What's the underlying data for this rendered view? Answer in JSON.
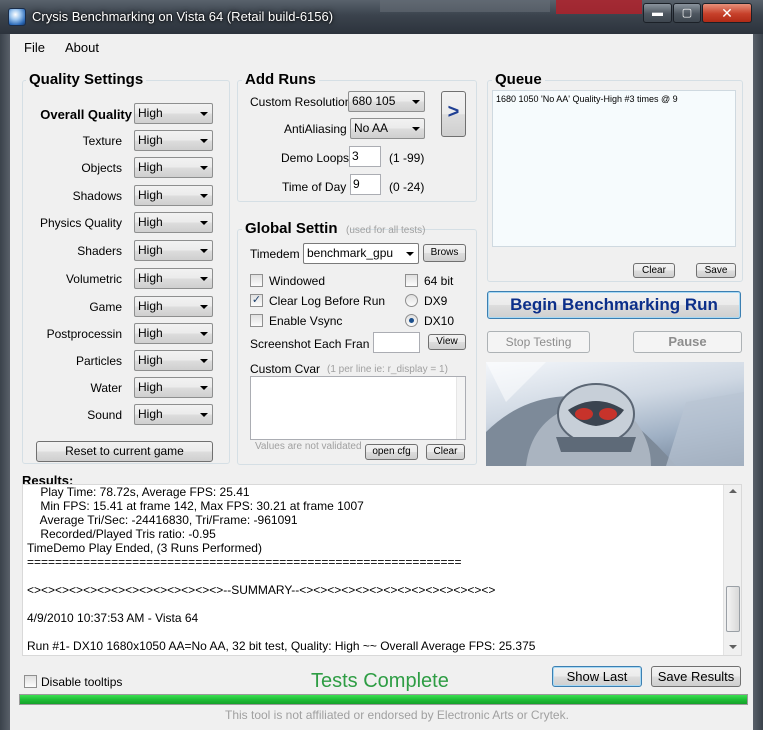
{
  "window": {
    "title": "Crysis Benchmarking on Vista 64 (Retail build-6156)",
    "minimize": "▬",
    "maximize": "▢",
    "close": "✕"
  },
  "menu": {
    "file": "File",
    "about": "About"
  },
  "quality": {
    "title": "Quality Settings",
    "overall_label": "Overall Quality",
    "overall_value": "High",
    "rows": [
      {
        "label": "Texture",
        "value": "High"
      },
      {
        "label": "Objects",
        "value": "High"
      },
      {
        "label": "Shadows",
        "value": "High"
      },
      {
        "label": "Physics Quality",
        "value": "High"
      },
      {
        "label": "Shaders",
        "value": "High"
      },
      {
        "label": "Volumetric",
        "value": "High"
      },
      {
        "label": "Game",
        "value": "High"
      },
      {
        "label": "Postprocessin",
        "value": "High"
      },
      {
        "label": "Particles",
        "value": "High"
      },
      {
        "label": "Water",
        "value": "High"
      },
      {
        "label": "Sound",
        "value": "High"
      }
    ],
    "reset_button": "Reset to current game"
  },
  "add_runs": {
    "title": "Add Runs",
    "resolution_label": "Custom Resolution",
    "resolution_value": "680 105",
    "aa_label": "AntiAliasing",
    "aa_value": "No AA",
    "loops_label": "Demo Loops",
    "loops_value": "3",
    "loops_range": "(1 -99)",
    "tod_label": "Time of Day",
    "tod_value": "9",
    "tod_range": "(0 -24)",
    "add_button": ">"
  },
  "global": {
    "title": "Global Settin",
    "subtitle": "(used for all tests)",
    "timedemo_label": "Timedem",
    "timedemo_value": "benchmark_gpu",
    "browse_button": "Brows",
    "windowed_label": "Windowed",
    "windowed_checked": false,
    "clearlog_label": "Clear Log Before Run",
    "clearlog_checked": true,
    "vsync_label": "Enable Vsync",
    "vsync_checked": false,
    "bit64_label": "64 bit",
    "bit64_checked": false,
    "dx9_label": "DX9",
    "dx10_label": "DX10",
    "dx_selected": "DX10",
    "screenshot_label": "Screenshot Each Fran",
    "screenshot_value": "",
    "view_button": "View",
    "cvar_label": "Custom Cvar",
    "cvar_hint": "(1 per line ie: r_display = 1)",
    "cvar_value": "",
    "validate_note": "Values are not validated",
    "opencfg_button": "open cfg",
    "clear_button": "Clear"
  },
  "queue": {
    "title": "Queue",
    "items": [
      "1680 1050 'No AA' Quality-High #3 times @ 9"
    ],
    "clear_button": "Clear",
    "save_button": "Save"
  },
  "actions": {
    "begin_button": "Begin Benchmarking Run",
    "stop_button": "Stop Testing",
    "pause_button": "Pause"
  },
  "results": {
    "title": "Results:",
    "lines": [
      "    Play Time: 78.72s, Average FPS: 25.41",
      "    Min FPS: 15.41 at frame 142, Max FPS: 30.21 at frame 1007",
      "    Average Tri/Sec: -24416830, Tri/Frame: -961091",
      "    Recorded/Played Tris ratio: -0.95",
      "TimeDemo Play Ended, (3 Runs Performed)",
      "==============================================================",
      "",
      "<><><><><><><><><><><><><><>--SUMMARY--<><><><><><><><><><><><><><>",
      "",
      "4/9/2010 10:37:53 AM - Vista 64",
      "",
      "Run #1- DX10 1680x1050 AA=No AA, 32 bit test, Quality: High ~~ Overall Average FPS: 25.375"
    ]
  },
  "footer": {
    "tooltips_label": "Disable tooltips",
    "tooltips_checked": false,
    "status": "Tests Complete",
    "show_last_button": "Show Last",
    "save_results_button": "Save Results",
    "progress_value": 1.0,
    "disclaimer": "This tool is not affiliated or endorsed by Electronic Arts or Crytek."
  },
  "colors": {
    "status_green": "#2e9d44",
    "begin_blue": "#0c2f8a",
    "progress_green": "#1fbe37"
  }
}
